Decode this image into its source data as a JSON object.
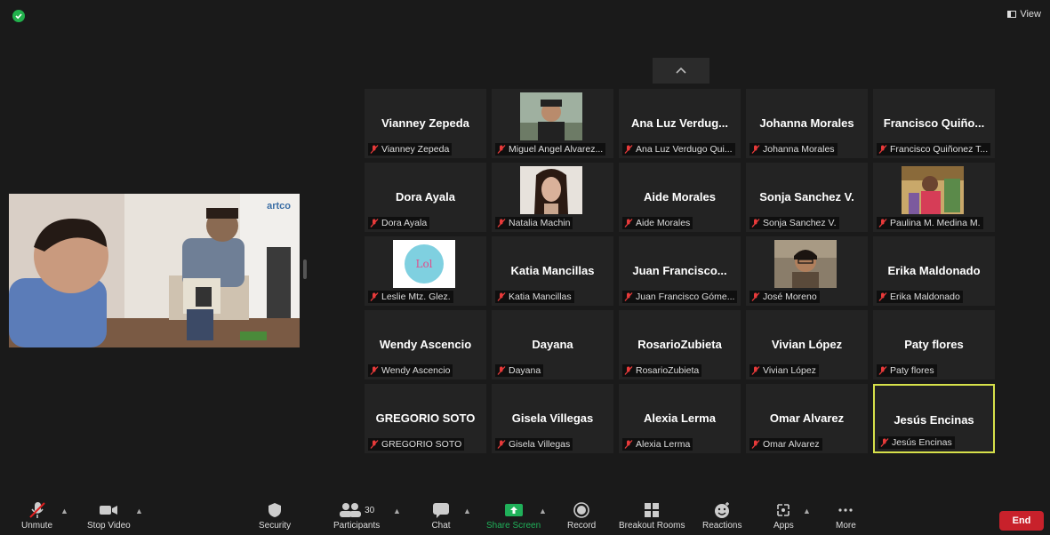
{
  "top": {
    "view_label": "View"
  },
  "speaker": {
    "logo_text": "artco",
    "name": ""
  },
  "participants": [
    {
      "display": "Vianney Zepeda",
      "name": "Vianney Zepeda"
    },
    {
      "display": "",
      "name": "Miguel Angel Alvarez..."
    },
    {
      "display": "Ana Luz Verdug...",
      "name": "Ana Luz Verdugo Qui..."
    },
    {
      "display": "Johanna Morales",
      "name": "Johanna Morales"
    },
    {
      "display": "Francisco Quiño...",
      "name": "Francisco Quiñonez T..."
    },
    {
      "display": "Dora Ayala",
      "name": "Dora Ayala"
    },
    {
      "display": "",
      "name": "Natalia Machin"
    },
    {
      "display": "Aide Morales",
      "name": "Aide Morales"
    },
    {
      "display": "Sonja Sanchez V.",
      "name": "Sonja Sanchez V."
    },
    {
      "display": "",
      "name": "Paulina M. Medina M."
    },
    {
      "display": "",
      "name": "Leslie Mtz. Glez."
    },
    {
      "display": "Katia Mancillas",
      "name": "Katia Mancillas"
    },
    {
      "display": "Juan Francisco...",
      "name": "Juan Francisco Góme..."
    },
    {
      "display": "",
      "name": "José Moreno"
    },
    {
      "display": "Erika Maldonado",
      "name": "Erika Maldonado"
    },
    {
      "display": "Wendy Ascencio",
      "name": "Wendy Ascencio"
    },
    {
      "display": "Dayana",
      "name": "Dayana"
    },
    {
      "display": "RosarioZubieta",
      "name": "RosarioZubieta"
    },
    {
      "display": "Vivian López",
      "name": "Vivian López"
    },
    {
      "display": "Paty flores",
      "name": "Paty flores"
    },
    {
      "display": "GREGORIO SOTO",
      "name": "GREGORIO SOTO"
    },
    {
      "display": "Gisela Villegas",
      "name": "Gisela Villegas"
    },
    {
      "display": "Alexia Lerma",
      "name": "Alexia Lerma"
    },
    {
      "display": "Omar Alvarez",
      "name": "Omar Alvarez"
    },
    {
      "display": "Jesús Encinas",
      "name": "Jesús Encinas"
    }
  ],
  "toolbar": {
    "unmute": "Unmute",
    "stop_video": "Stop Video",
    "security": "Security",
    "participants": "Participants",
    "participants_count": "30",
    "chat": "Chat",
    "share_screen": "Share Screen",
    "record": "Record",
    "breakout_rooms": "Breakout Rooms",
    "reactions": "Reactions",
    "apps": "Apps",
    "more": "More",
    "end": "End"
  },
  "colors": {
    "active_speaker": "#d6e04a",
    "share_green": "#20b15a",
    "end_red": "#c8212b",
    "shield_green": "#22b14c"
  },
  "icons": [
    "shield-icon",
    "view-icon",
    "chevron-up-icon",
    "mic-muted-icon",
    "camera-icon",
    "security-shield-icon",
    "participants-icon",
    "chat-icon",
    "share-screen-icon",
    "record-icon",
    "breakout-rooms-icon",
    "reactions-icon",
    "apps-icon",
    "more-icon"
  ]
}
